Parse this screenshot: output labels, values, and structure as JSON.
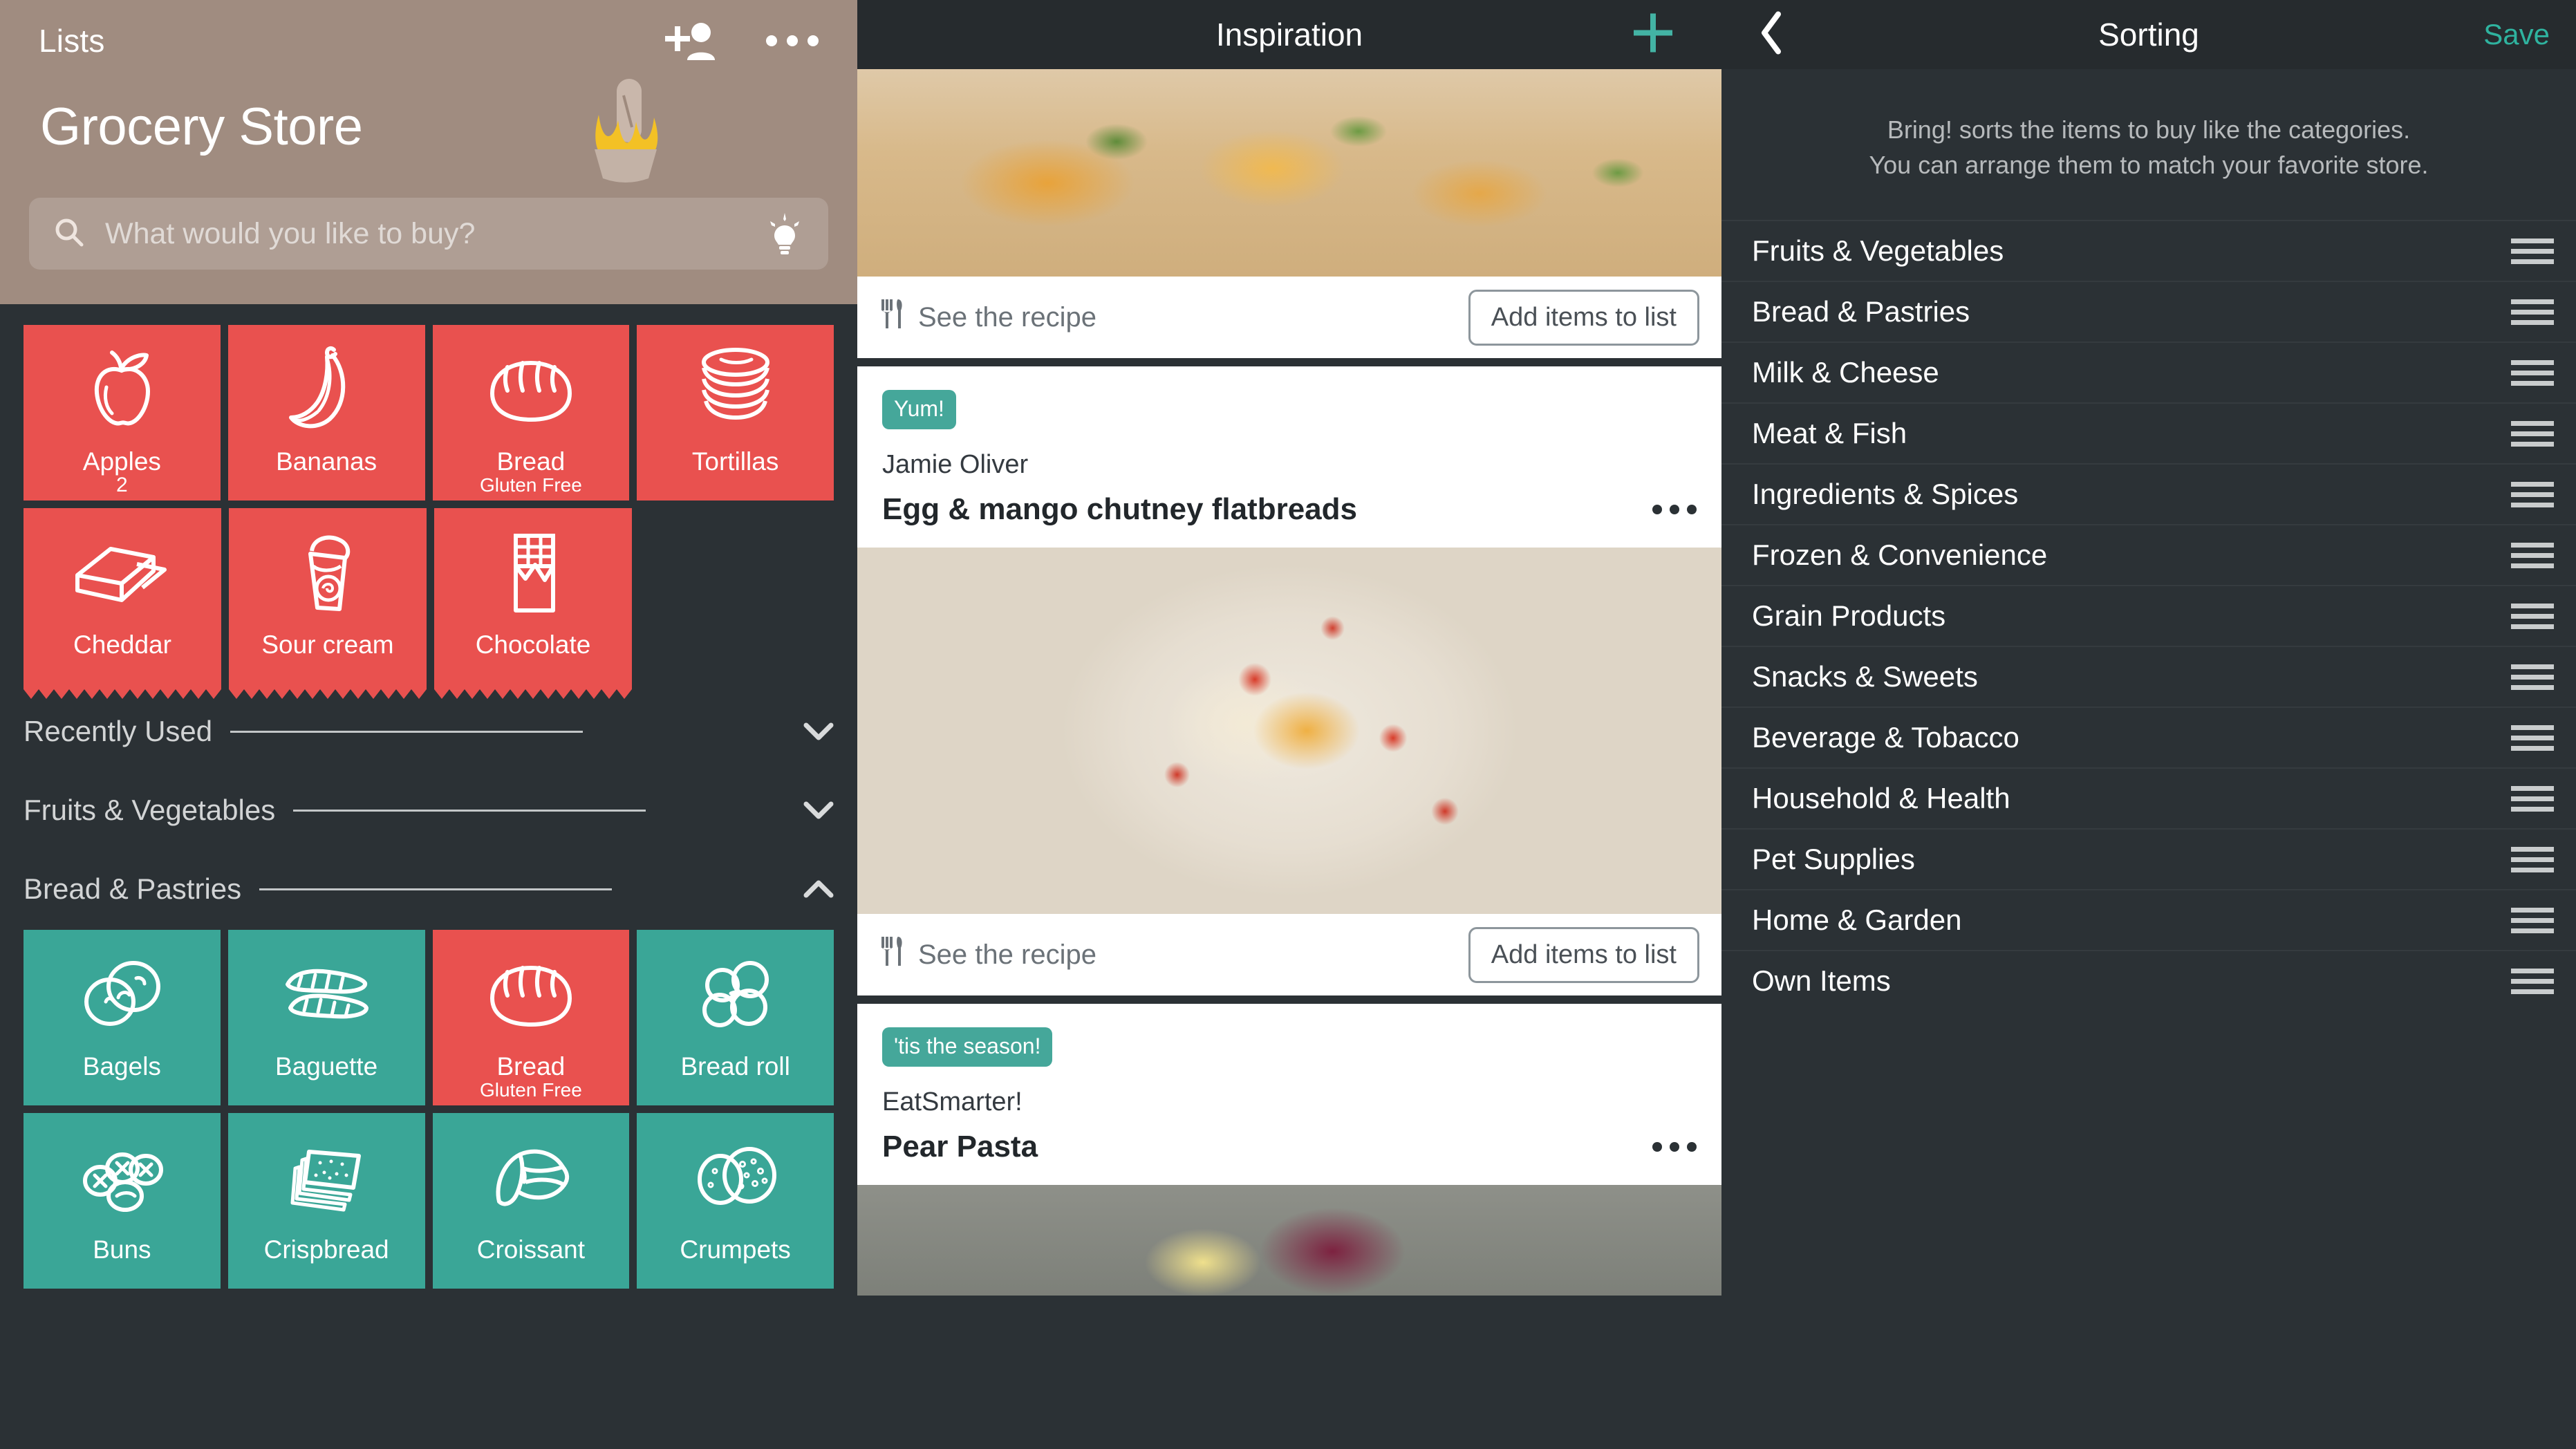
{
  "colors": {
    "accent_teal": "#3aa697",
    "accent_red": "#e9514f",
    "header_brown": "#a08c80",
    "dark_bg": "#2b3135",
    "nav_bar": "#262b2e",
    "save_green": "#2fb39f"
  },
  "left_panel": {
    "back_label": "Lists",
    "store_title": "Grocery Store",
    "add_person_icon": "add-person-icon",
    "more_icon": "more-options-icon",
    "search": {
      "placeholder": "What would you like to buy?",
      "search_icon": "search-icon",
      "bulb_icon": "lightbulb-icon"
    },
    "active_items": [
      {
        "label": "Apples",
        "sub": "",
        "qty": "2",
        "color": "red",
        "icon": "apple-icon"
      },
      {
        "label": "Bananas",
        "sub": "",
        "qty": "",
        "color": "red",
        "icon": "banana-icon"
      },
      {
        "label": "Bread",
        "sub": "Gluten Free",
        "qty": "",
        "color": "red",
        "icon": "bread-loaf-icon"
      },
      {
        "label": "Tortillas",
        "sub": "",
        "qty": "",
        "color": "red",
        "icon": "tortilla-stack-icon"
      },
      {
        "label": "Cheddar",
        "sub": "",
        "qty": "",
        "color": "red",
        "icon": "cheese-block-icon"
      },
      {
        "label": "Sour cream",
        "sub": "",
        "qty": "",
        "color": "red",
        "icon": "sour-cream-cup-icon"
      },
      {
        "label": "Chocolate",
        "sub": "",
        "qty": "",
        "color": "red",
        "icon": "chocolate-bar-icon"
      }
    ],
    "sections": [
      {
        "title": "Recently Used",
        "expanded": false,
        "chevron": "chevron-down-icon"
      },
      {
        "title": "Fruits & Vegetables",
        "expanded": false,
        "chevron": "chevron-down-icon"
      },
      {
        "title": "Bread & Pastries",
        "expanded": true,
        "chevron": "chevron-up-icon"
      }
    ],
    "bread_items": [
      {
        "label": "Bagels",
        "sub": "",
        "color": "teal",
        "icon": "bagel-icon"
      },
      {
        "label": "Baguette",
        "sub": "",
        "color": "teal",
        "icon": "baguette-icon"
      },
      {
        "label": "Bread",
        "sub": "Gluten Free",
        "color": "red",
        "icon": "bread-loaf-icon"
      },
      {
        "label": "Bread roll",
        "sub": "",
        "color": "teal",
        "icon": "bread-roll-icon"
      },
      {
        "label": "Buns",
        "sub": "",
        "color": "teal",
        "icon": "buns-icon"
      },
      {
        "label": "Crispbread",
        "sub": "",
        "color": "teal",
        "icon": "crispbread-icon"
      },
      {
        "label": "Croissant",
        "sub": "",
        "color": "teal",
        "icon": "croissant-icon"
      },
      {
        "label": "Crumpets",
        "sub": "",
        "color": "teal",
        "icon": "crumpets-icon"
      }
    ]
  },
  "middle_panel": {
    "title": "Inspiration",
    "add_icon": "plus-icon",
    "cards": [
      {
        "photo": "flatbread",
        "badge": "",
        "source": "",
        "title": "",
        "see_recipe": "See the recipe",
        "add_items": "Add items to list",
        "cutlery_icon": "cutlery-icon",
        "more_icon": "more-options-icon"
      },
      {
        "photo": "egg",
        "badge": "Yum!",
        "source": "Jamie Oliver",
        "title": "Egg & mango chutney flatbreads",
        "see_recipe": "See the recipe",
        "add_items": "Add items to list",
        "cutlery_icon": "cutlery-icon",
        "more_icon": "more-options-icon"
      },
      {
        "photo": "pasta",
        "badge": "'tis the season!",
        "source": "EatSmarter!",
        "title": "Pear Pasta",
        "see_recipe": "",
        "add_items": "",
        "cutlery_icon": "cutlery-icon",
        "more_icon": "more-options-icon"
      }
    ]
  },
  "right_panel": {
    "back_icon": "chevron-left-icon",
    "title": "Sorting",
    "save_label": "Save",
    "description": "Bring! sorts the items to buy like the categories.\nYou can arrange them to match your favorite store.",
    "description_line1": "Bring! sorts the items to buy like the categories.",
    "description_line2": "You can arrange them to match your favorite store.",
    "categories": [
      "Fruits & Vegetables",
      "Bread & Pastries",
      "Milk & Cheese",
      "Meat & Fish",
      "Ingredients & Spices",
      "Frozen & Convenience",
      "Grain Products",
      "Snacks & Sweets",
      "Beverage & Tobacco",
      "Household & Health",
      "Pet Supplies",
      "Home & Garden",
      "Own Items"
    ],
    "drag_handle_icon": "drag-handle-icon"
  }
}
